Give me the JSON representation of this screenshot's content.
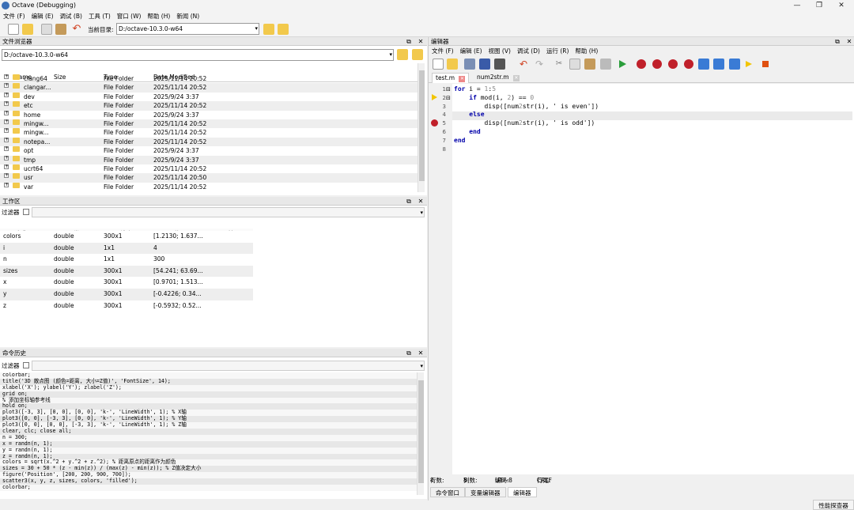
{
  "window": {
    "title": "Octave (Debugging)"
  },
  "menu": [
    "文件 (F)",
    "编辑 (E)",
    "调试 (B)",
    "工具 (T)",
    "窗口 (W)",
    "帮助 (H)",
    "新闻 (N)"
  ],
  "toolbar": {
    "current_dir_label": "当前目录:",
    "current_dir": "D:/octave-10.3.0-w64"
  },
  "file_browser": {
    "title": "文件浏览器",
    "path": "D:/octave-10.3.0-w64",
    "columns": [
      "Name",
      "Size",
      "Type",
      "Date Modified"
    ],
    "rows": [
      {
        "name": "clang64",
        "type": "File Folder",
        "date": "2025/11/14 20:52"
      },
      {
        "name": "clangar...",
        "type": "File Folder",
        "date": "2025/11/14 20:52"
      },
      {
        "name": "dev",
        "type": "File Folder",
        "date": "2025/9/24 3:37"
      },
      {
        "name": "etc",
        "type": "File Folder",
        "date": "2025/11/14 20:52"
      },
      {
        "name": "home",
        "type": "File Folder",
        "date": "2025/9/24 3:37"
      },
      {
        "name": "mingw...",
        "type": "File Folder",
        "date": "2025/11/14 20:52"
      },
      {
        "name": "mingw...",
        "type": "File Folder",
        "date": "2025/11/14 20:52"
      },
      {
        "name": "notepa...",
        "type": "File Folder",
        "date": "2025/11/14 20:52"
      },
      {
        "name": "opt",
        "type": "File Folder",
        "date": "2025/9/24 3:37"
      },
      {
        "name": "tmp",
        "type": "File Folder",
        "date": "2025/9/24 3:37"
      },
      {
        "name": "ucrt64",
        "type": "File Folder",
        "date": "2025/11/14 20:52"
      },
      {
        "name": "usr",
        "type": "File Folder",
        "date": "2025/11/14 20:50"
      },
      {
        "name": "var",
        "type": "File Folder",
        "date": "2025/11/14 20:52"
      }
    ]
  },
  "workspace": {
    "title": "工作区",
    "filter_label": "过滤器",
    "columns": [
      "名称",
      "类",
      "维度",
      "值",
      "属性"
    ],
    "rows": [
      {
        "name": "colors",
        "class": "double",
        "dim": "300x1",
        "value": "[1.2130; 1.637..."
      },
      {
        "name": "i",
        "class": "double",
        "dim": "1x1",
        "value": "4"
      },
      {
        "name": "n",
        "class": "double",
        "dim": "1x1",
        "value": "300"
      },
      {
        "name": "sizes",
        "class": "double",
        "dim": "300x1",
        "value": "[54.241; 63.69..."
      },
      {
        "name": "x",
        "class": "double",
        "dim": "300x1",
        "value": "[0.9701; 1.513..."
      },
      {
        "name": "y",
        "class": "double",
        "dim": "300x1",
        "value": "[-0.4226; 0.34..."
      },
      {
        "name": "z",
        "class": "double",
        "dim": "300x1",
        "value": "[-0.5932; 0.52..."
      }
    ]
  },
  "history": {
    "title": "命令历史",
    "filter_label": "过滤器",
    "lines": [
      "colorbar;",
      "title('3D 散点图 (颜色=距离, 大小=Z值)', 'FontSize', 14);",
      "xlabel('X'); ylabel('Y'); zlabel('Z');",
      "grid on;",
      "% 添加坐标轴参考线",
      "hold on;",
      "plot3([-3, 3], [0, 0], [0, 0], 'k-', 'LineWidth', 1); % X轴",
      "plot3([0, 0], [-3, 3], [0, 0], 'k-', 'LineWidth', 1); % Y轴",
      "plot3([0, 0], [0, 0], [-3, 3], 'k-', 'LineWidth', 1); % Z轴",
      "clear, clc; close all;",
      "n = 300;",
      "x = randn(n, 1);",
      "y = randn(n, 1);",
      "z = randn(n, 1);",
      "colors = sqrt(x.^2 + y.^2 + z.^2); % 距离原点的距离作为颜色",
      "sizes = 30 + 50 * (z - min(z)) / (max(z) - min(z)); % Z值决定大小",
      "figure('Position', [200, 200, 900, 700]);",
      "scatter3(x, y, z, sizes, colors, 'filled');",
      "colorbar;"
    ]
  },
  "editor": {
    "title": "编辑器",
    "menu": [
      "文件 (F)",
      "编辑 (E)",
      "视图 (V)",
      "调试 (D)",
      "运行 (R)",
      "帮助 (H)"
    ],
    "tabs": [
      "test.m",
      "num2str.m"
    ],
    "line_numbers": [
      "1",
      "2",
      "3",
      "4",
      "5",
      "6",
      "7",
      "8"
    ],
    "code": [
      "for i = 1:5",
      "    if mod(i, 2) == 0",
      "        disp([num2str(i), ' is even'])",
      "    else",
      "        disp([num2str(i), ' is odd'])",
      "    end",
      "end",
      ""
    ],
    "status": {
      "line_label": "行数:",
      "line": "4",
      "col_label": "列数:",
      "col": "8",
      "enc_label": "编码:",
      "enc": "UTF-8",
      "eol_label": "行尾:",
      "eol": "CRLF"
    },
    "bottom_tabs": [
      "命令窗口",
      "变量编辑器",
      "编辑器"
    ]
  },
  "bottom_right": "性能探查器",
  "colors": {
    "breakpoint": "#c0202a",
    "debug_arrow": "#f2c500",
    "accent": "#0000aa"
  }
}
